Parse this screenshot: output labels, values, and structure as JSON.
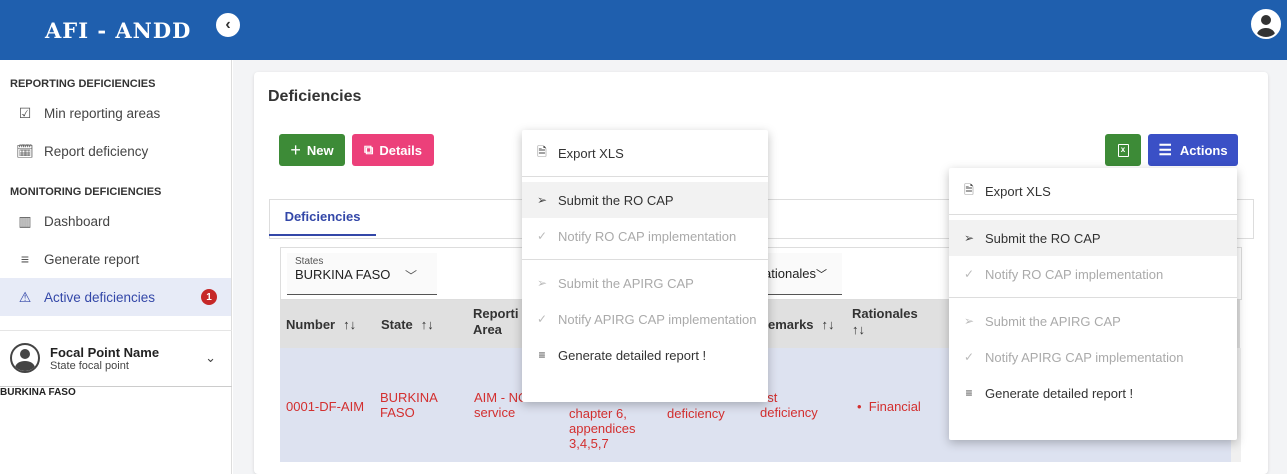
{
  "app": {
    "title": "AFI - ANDD"
  },
  "sidebar": {
    "sections": [
      {
        "title": "REPORTING DEFICIENCIES"
      },
      {
        "title": "MONITORING DEFICIENCIES"
      }
    ],
    "items": [
      {
        "label": "Min reporting areas",
        "icon": "checkbox-icon"
      },
      {
        "label": "Report deficiency",
        "icon": "calendar-icon"
      },
      {
        "label": "Dashboard",
        "icon": "bar-chart-icon"
      },
      {
        "label": "Generate report",
        "icon": "list-icon"
      },
      {
        "label": "Active deficiencies",
        "icon": "warning-icon",
        "badge": "1"
      }
    ],
    "profile": {
      "name": "Focal Point Name",
      "role": "State focal point"
    },
    "country": "BURKINA FASO"
  },
  "page": {
    "title": "Deficiencies",
    "buttons": {
      "new": "New",
      "details": "Details",
      "actions": "Actions"
    },
    "tab": "Deficiencies",
    "filters": {
      "states_label": "States",
      "states_value": "BURKINA FASO",
      "rationales_value": "ationales"
    }
  },
  "table": {
    "headers": {
      "number": "Number",
      "state": "State",
      "area1": "Reporti",
      "area2": "Area",
      "remarks": "emarks",
      "rationales1": "Rationales",
      "sort": "↑↓"
    },
    "row": {
      "number": "0001-DF-AIM",
      "state1": "BURKINA",
      "state2": "FASO",
      "area1": "AIM - NC",
      "area2": "service",
      "ref1": "chapter 6,",
      "ref2": "appendices",
      "ref3": "3,4,5,7",
      "desc": "deficiency",
      "remarks1": "est",
      "remarks2": "deficiency",
      "rationale": "Financial"
    }
  },
  "menu_left": {
    "items": [
      {
        "label": "Export XLS",
        "disabled": false
      },
      {
        "label": "Submit the RO CAP",
        "disabled": false
      },
      {
        "label": "Notify RO CAP implementation",
        "disabled": true
      },
      {
        "label": "Submit the APIRG CAP",
        "disabled": true
      },
      {
        "label": "Notify APIRG CAP implementation",
        "disabled": true
      },
      {
        "label": "Generate detailed report !",
        "disabled": false
      }
    ]
  },
  "menu_right": {
    "items": [
      {
        "label": "Export XLS",
        "disabled": false
      },
      {
        "label": "Submit the RO CAP",
        "disabled": false
      },
      {
        "label": "Notify RO CAP implementation",
        "disabled": true
      },
      {
        "label": "Submit the APIRG CAP",
        "disabled": true
      },
      {
        "label": "Notify APIRG CAP implementation",
        "disabled": true
      },
      {
        "label": "Generate detailed report !",
        "disabled": false
      }
    ]
  },
  "colors": {
    "topbar": "#1f5fae",
    "new": "#3d8b37",
    "details": "#ec407a",
    "actions": "#3a50c6",
    "row_text": "#d32f2f"
  }
}
